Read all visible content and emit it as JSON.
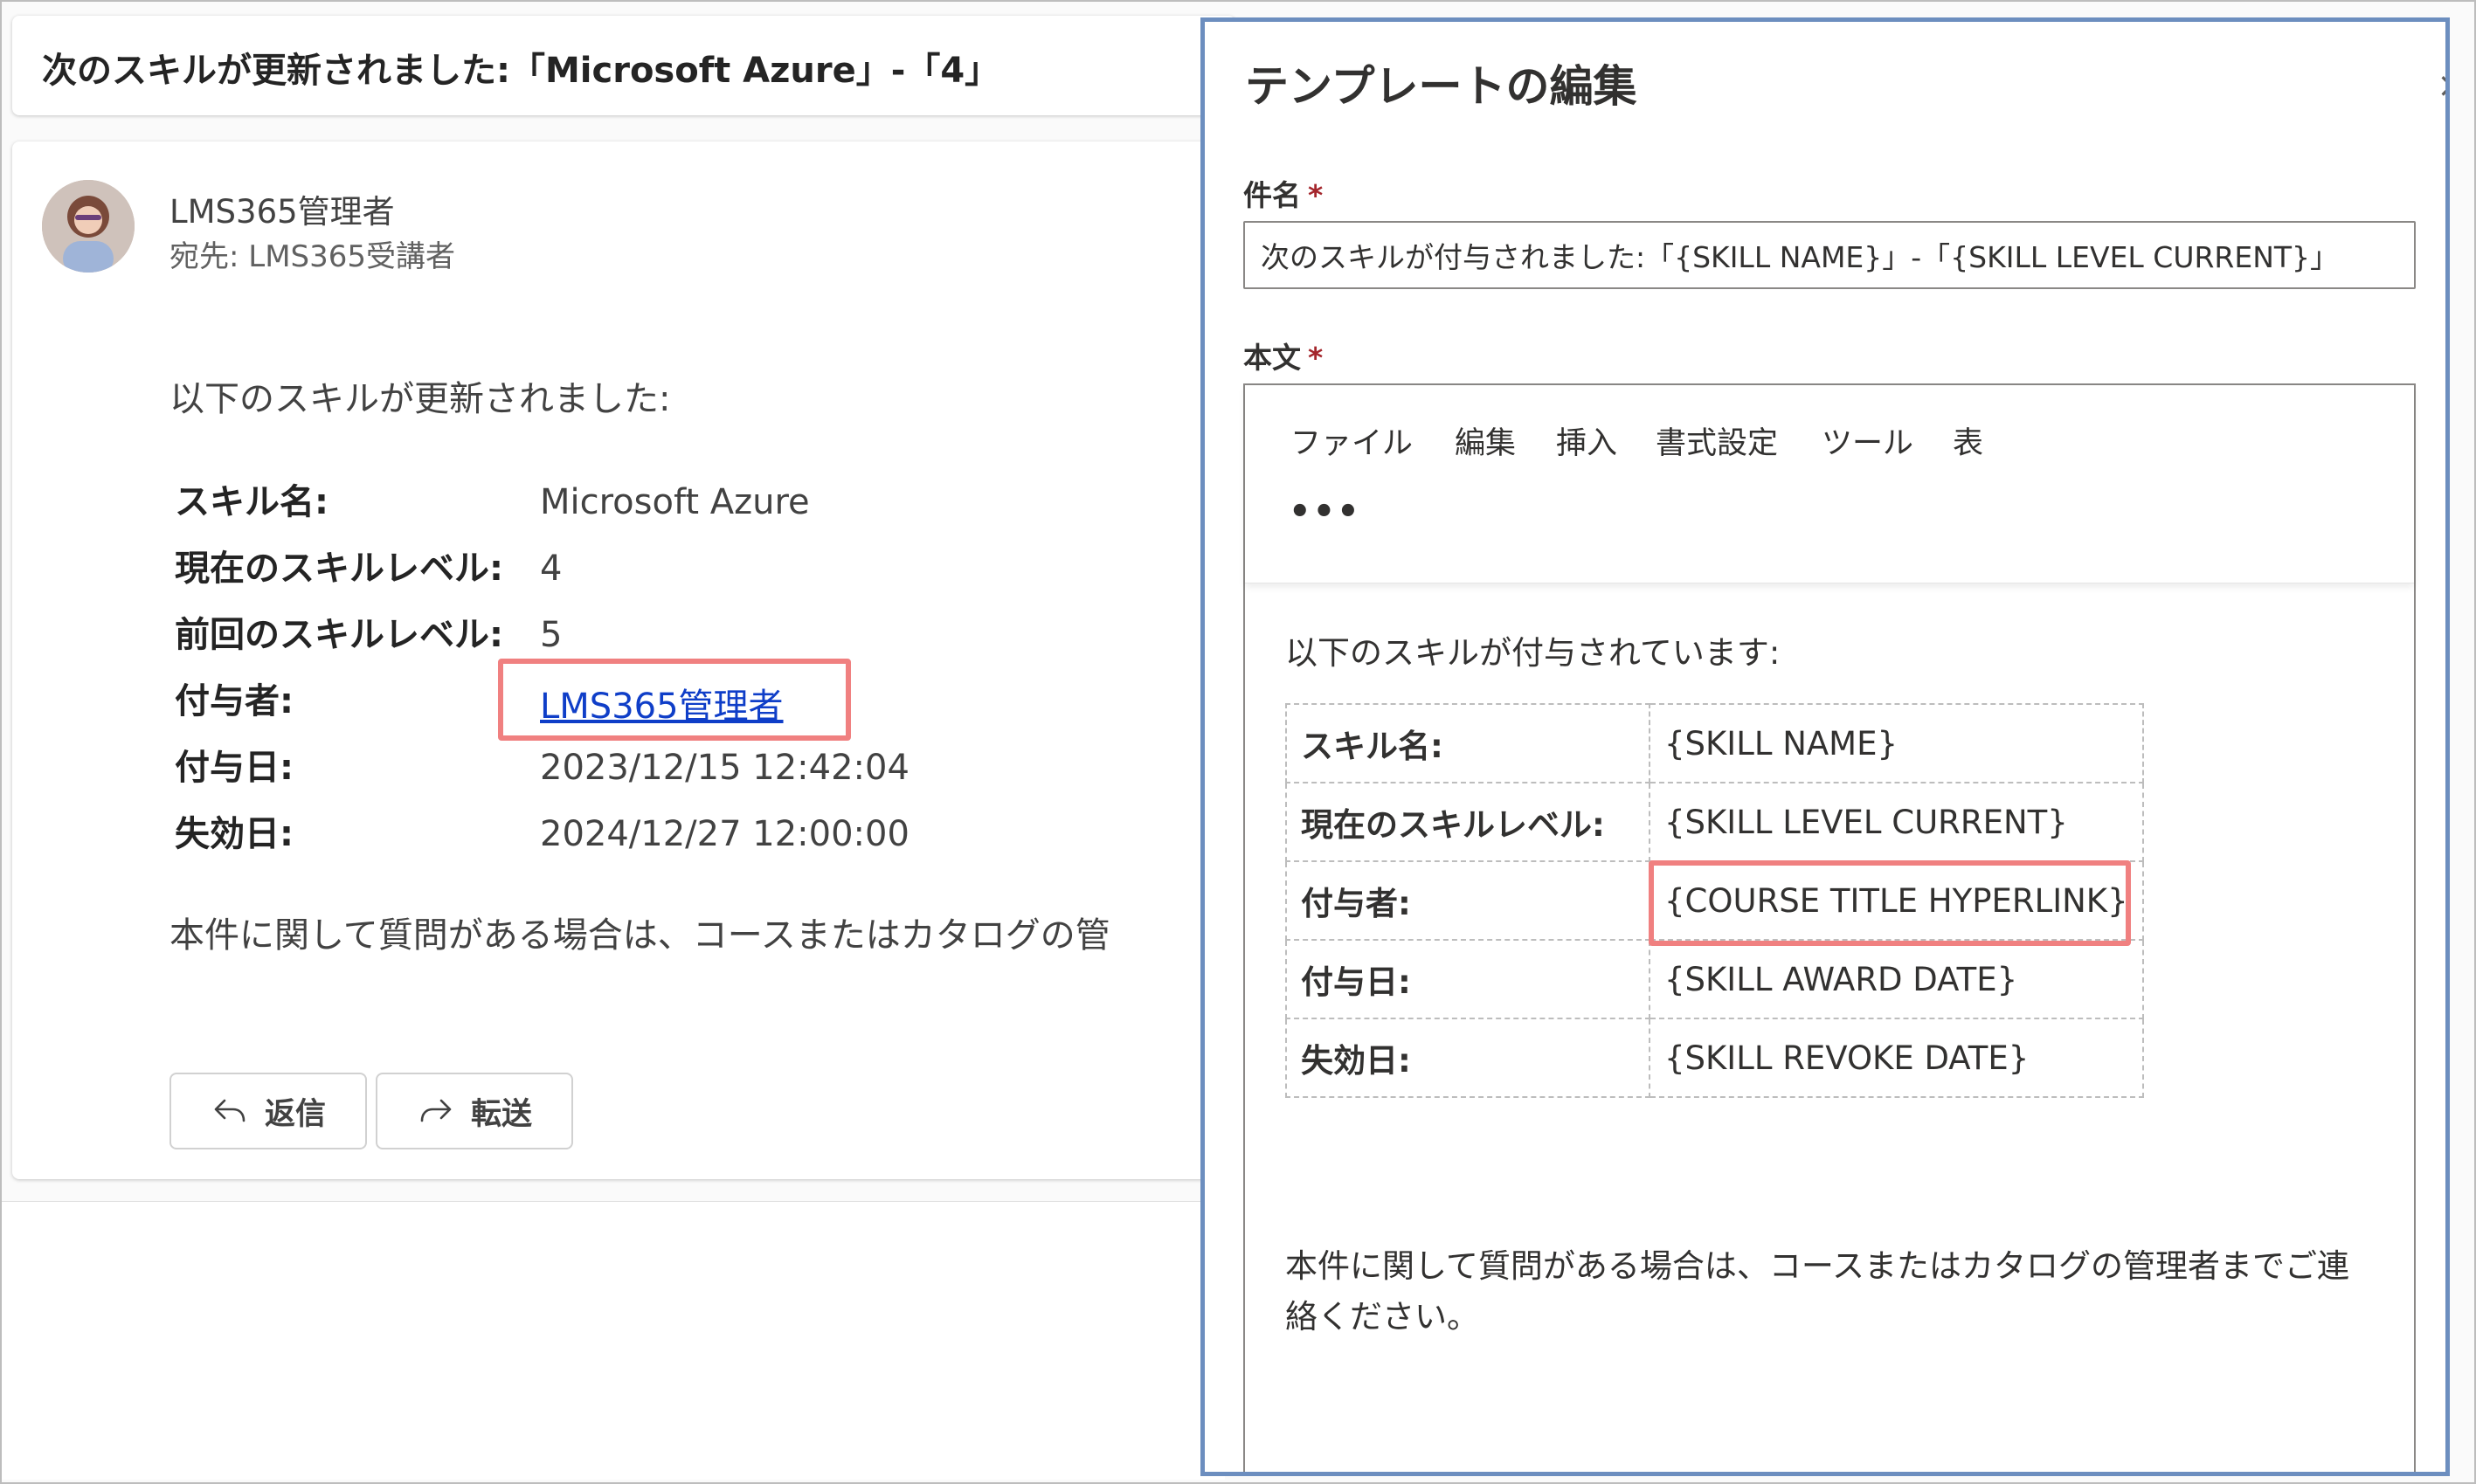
{
  "email": {
    "subject": "次のスキルが更新されました:「Microsoft Azure」-「4」",
    "sender": "LMS365管理者",
    "recipient": "宛先:  LMS365受講者",
    "intro": "以下のスキルが更新されました:",
    "fields": [
      {
        "label": "スキル名:",
        "value": "Microsoft Azure"
      },
      {
        "label": "現在のスキルレベル:",
        "value": "4"
      },
      {
        "label": "前回のスキルレベル:",
        "value": "5"
      },
      {
        "label": "付与者:",
        "value": "LMS365管理者"
      },
      {
        "label": "付与日:",
        "value": "2023/12/15 12:42:04"
      },
      {
        "label": "失効日:",
        "value": "2024/12/27 12:00:00"
      }
    ],
    "footer": "本件に関して質問がある場合は、コースまたはカタログの管",
    "reply_label": "返信",
    "forward_label": "転送"
  },
  "template_editor": {
    "title": "テンプレートの編集",
    "close_glyph": "×",
    "subject_label": "件名",
    "subject_value": "次のスキルが付与されました:「{SKILL NAME}」-「{SKILL LEVEL CURRENT}」",
    "body_label": "本文",
    "required_mark": "*",
    "menu": [
      "ファイル",
      "編集",
      "挿入",
      "書式設定",
      "ツール",
      "表"
    ],
    "more_glyph": "•••",
    "intro": "以下のスキルが付与されています:",
    "rows": [
      {
        "label": "スキル名:",
        "value": "{SKILL NAME}"
      },
      {
        "label": "現在のスキルレベル:",
        "value": "{SKILL LEVEL CURRENT}"
      },
      {
        "label": "付与者:",
        "value": "{COURSE TITLE HYPERLINK}"
      },
      {
        "label": "付与日:",
        "value": "{SKILL AWARD DATE}"
      },
      {
        "label": "失効日:",
        "value": "{SKILL REVOKE DATE}"
      }
    ],
    "footer": "本件に関して質問がある場合は、コースまたはカタログの管理者までご連絡ください。"
  },
  "colors": {
    "highlight": "#f08080",
    "panel_border": "#6c8ebf",
    "link": "#0f3ec8"
  }
}
